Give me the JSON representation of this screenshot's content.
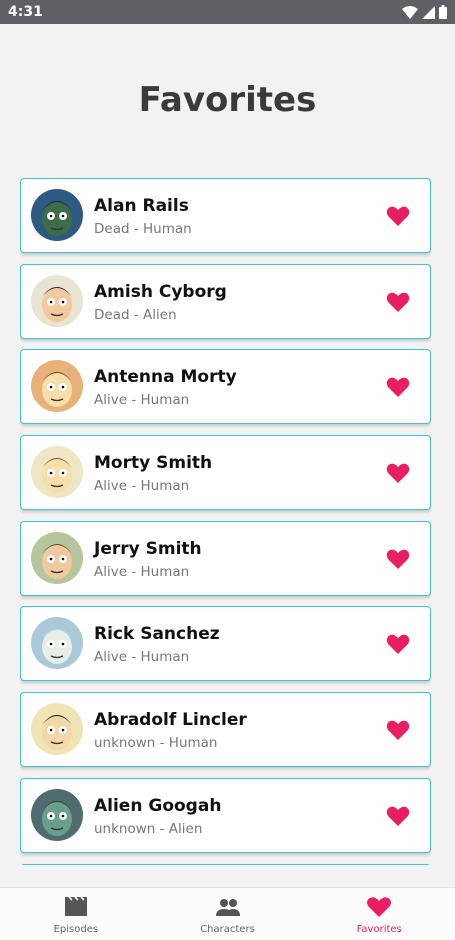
{
  "status_bar": {
    "time": "4:31",
    "icons": [
      "wifi-icon",
      "signal-icon",
      "battery-icon"
    ]
  },
  "page": {
    "title": "Favorites"
  },
  "accent_color": "#e91e63",
  "card_border_color": "#3fc4d0",
  "favorites": [
    {
      "name": "Alan Rails",
      "status": "Dead - Human"
    },
    {
      "name": "Amish Cyborg",
      "status": "Dead - Alien"
    },
    {
      "name": "Antenna Morty",
      "status": "Alive - Human"
    },
    {
      "name": "Morty Smith",
      "status": "Alive - Human"
    },
    {
      "name": "Jerry Smith",
      "status": "Alive - Human"
    },
    {
      "name": "Rick Sanchez",
      "status": "Alive - Human"
    },
    {
      "name": "Abradolf Lincler",
      "status": "unknown - Human"
    },
    {
      "name": "Alien Googah",
      "status": "unknown - Alien"
    }
  ],
  "bottom_nav": {
    "items": [
      {
        "label": "Episodes",
        "icon": "clapperboard-icon"
      },
      {
        "label": "Characters",
        "icon": "people-icon"
      },
      {
        "label": "Favorites",
        "icon": "heart-icon"
      }
    ],
    "active": "Favorites"
  }
}
